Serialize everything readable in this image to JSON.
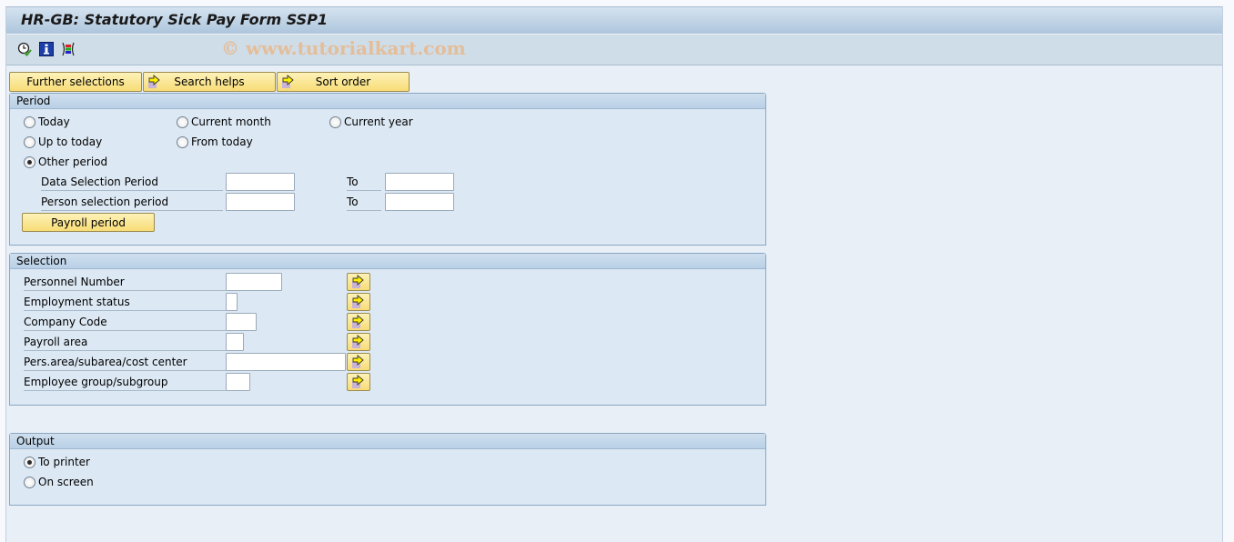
{
  "window": {
    "title": "HR-GB: Statutory Sick Pay Form SSP1",
    "watermark": "© www.tutorialkart.com"
  },
  "appbar": {
    "icons": [
      "execute-icon",
      "information-icon",
      "variants-icon"
    ]
  },
  "toolbar": {
    "further_selections": "Further selections",
    "search_helps": "Search helps",
    "sort_order": "Sort order"
  },
  "period": {
    "title": "Period",
    "options": {
      "today": "Today",
      "current_month": "Current month",
      "current_year": "Current year",
      "up_to_today": "Up to today",
      "from_today": "From today",
      "other_period": "Other period"
    },
    "selected": "other_period",
    "data_selection_label": "Data Selection Period",
    "person_selection_label": "Person selection period",
    "to_label": "To",
    "data_selection_from": "",
    "data_selection_to": "",
    "person_selection_from": "",
    "person_selection_to": "",
    "payroll_period_button": "Payroll period"
  },
  "selection": {
    "title": "Selection",
    "fields": [
      {
        "label": "Personnel Number",
        "value": ""
      },
      {
        "label": "Employment status",
        "value": ""
      },
      {
        "label": "Company Code",
        "value": ""
      },
      {
        "label": "Payroll area",
        "value": ""
      },
      {
        "label": "Pers.area/subarea/cost center",
        "value": ""
      },
      {
        "label": "Employee group/subgroup",
        "value": ""
      }
    ]
  },
  "output": {
    "title": "Output",
    "options": {
      "to_printer": "To printer",
      "on_screen": "On screen"
    },
    "selected": "to_printer"
  }
}
